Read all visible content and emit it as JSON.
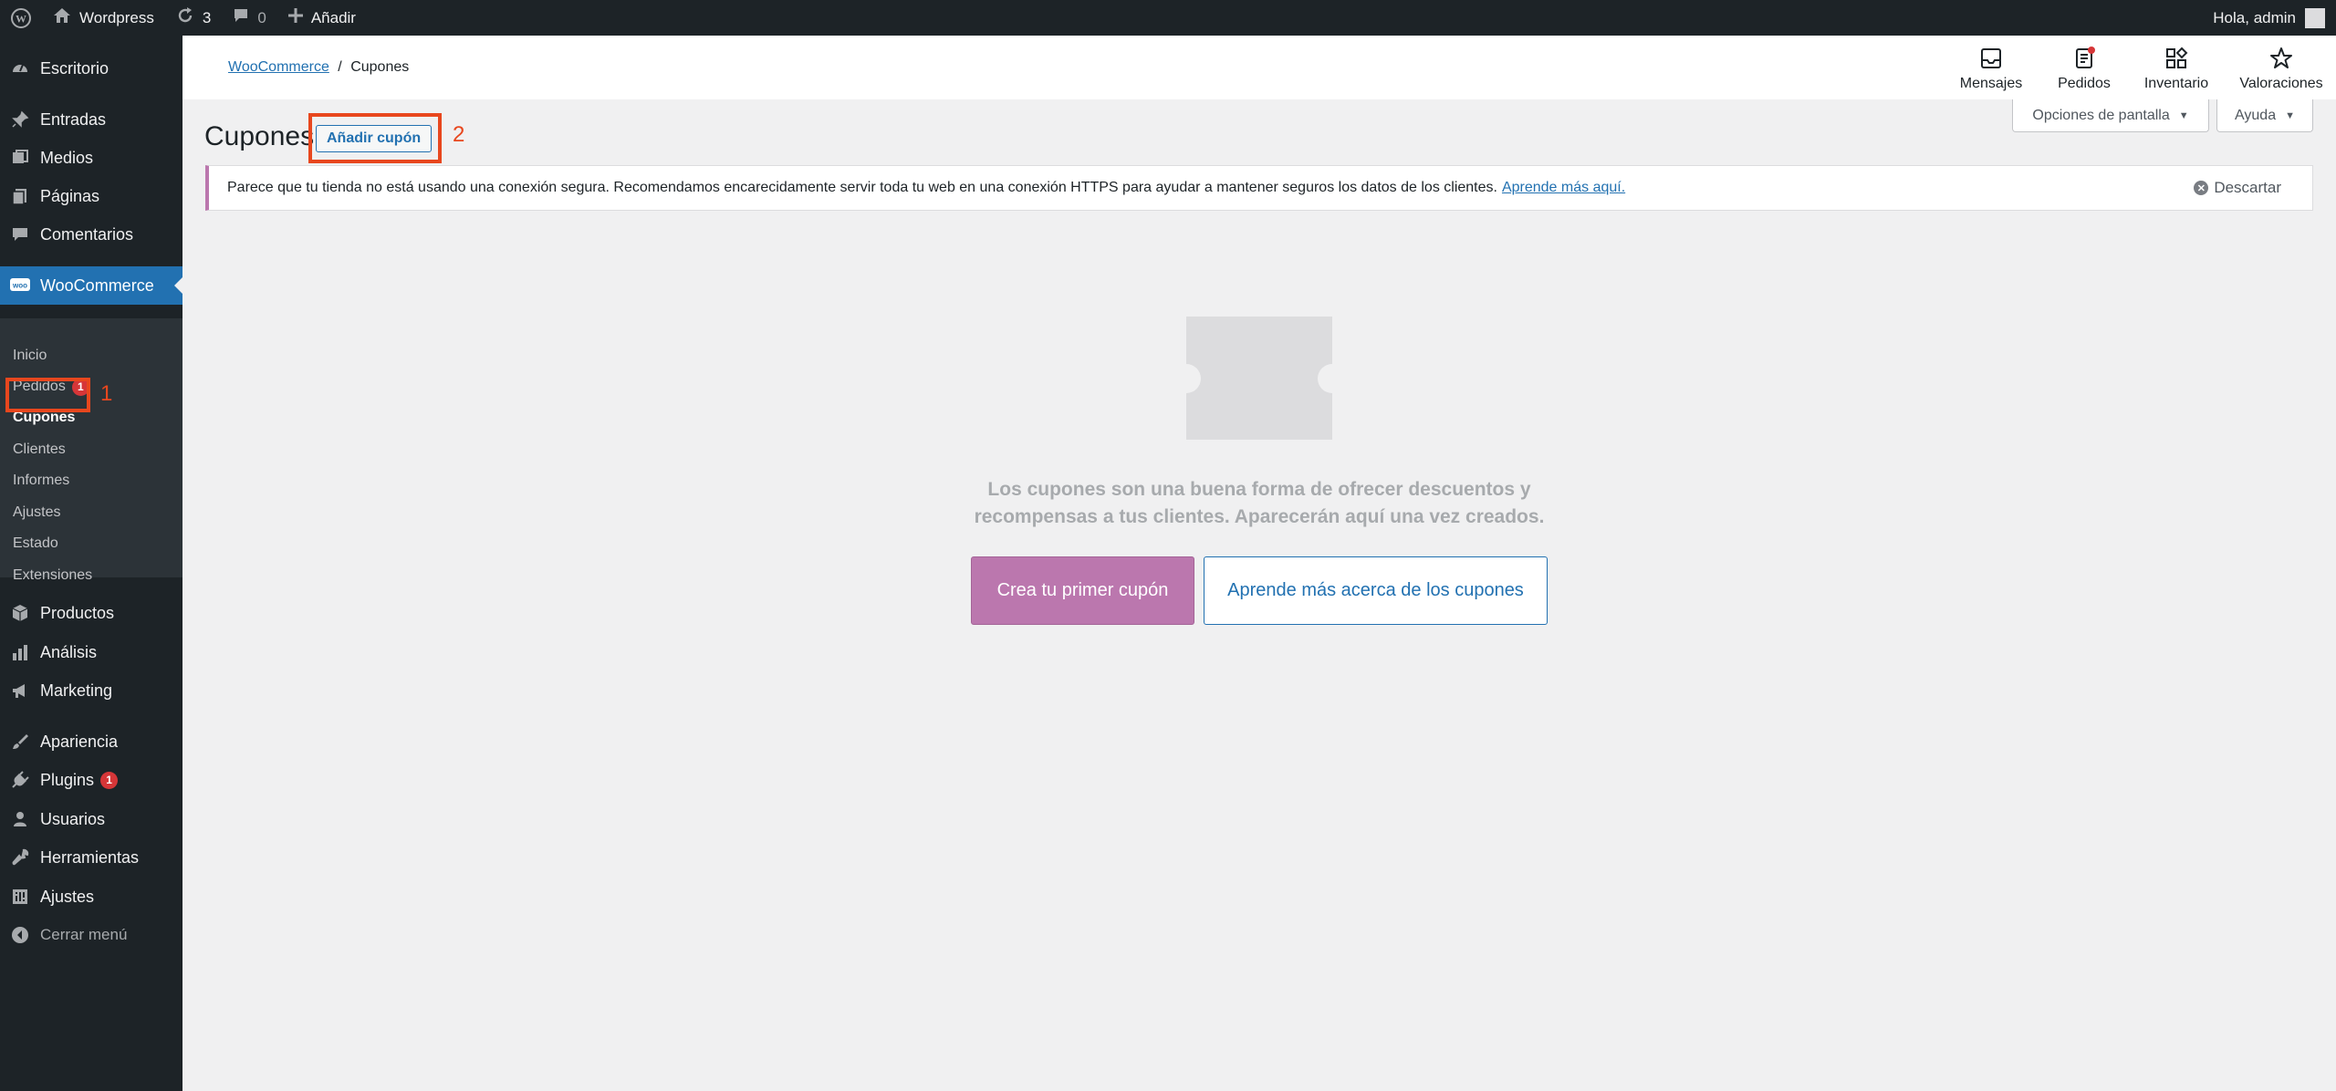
{
  "admin_bar": {
    "site_name": "Wordpress",
    "updates_count": "3",
    "comments_count": "0",
    "new_label": "Añadir",
    "greeting": "Hola, admin"
  },
  "sidebar": {
    "items": [
      {
        "label": "Escritorio",
        "icon": "dashboard-icon"
      },
      {
        "label": "Entradas",
        "icon": "pin-icon"
      },
      {
        "label": "Medios",
        "icon": "media-icon"
      },
      {
        "label": "Páginas",
        "icon": "pages-icon"
      },
      {
        "label": "Comentarios",
        "icon": "comment-icon"
      },
      {
        "label": "WooCommerce",
        "icon": "woo-icon"
      },
      {
        "label": "Productos",
        "icon": "box-icon"
      },
      {
        "label": "Análisis",
        "icon": "bar-chart-icon"
      },
      {
        "label": "Marketing",
        "icon": "megaphone-icon"
      },
      {
        "label": "Apariencia",
        "icon": "brush-icon"
      },
      {
        "label": "Plugins",
        "icon": "plugin-icon",
        "badge": "1"
      },
      {
        "label": "Usuarios",
        "icon": "user-icon"
      },
      {
        "label": "Herramientas",
        "icon": "wrench-icon"
      },
      {
        "label": "Ajustes",
        "icon": "settings-icon"
      }
    ],
    "collapse_label": "Cerrar menú",
    "submenu": [
      {
        "label": "Inicio"
      },
      {
        "label": "Pedidos",
        "badge": "1"
      },
      {
        "label": "Cupones"
      },
      {
        "label": "Clientes"
      },
      {
        "label": "Informes"
      },
      {
        "label": "Ajustes"
      },
      {
        "label": "Estado"
      },
      {
        "label": "Extensiones"
      }
    ]
  },
  "header": {
    "breadcrumb_root": "WooCommerce",
    "breadcrumb_sep": "/",
    "breadcrumb_current": "Cupones",
    "actions": [
      {
        "label": "Mensajes",
        "icon": "inbox-icon"
      },
      {
        "label": "Pedidos",
        "icon": "orders-icon"
      },
      {
        "label": "Inventario",
        "icon": "inventory-icon"
      },
      {
        "label": "Valoraciones",
        "icon": "star-icon"
      }
    ]
  },
  "screen_options_label": "Opciones de pantalla",
  "help_label": "Ayuda",
  "page": {
    "title": "Cupones",
    "add_button": "Añadir cupón"
  },
  "annotations": {
    "one": "1",
    "two": "2",
    "color": "#e8471e"
  },
  "notice": {
    "text": "Parece que tu tienda no está usando una conexión segura. Recomendamos encarecidamente servir toda tu web en una conexión HTTPS para ayudar a mantener seguros los datos de los clientes.",
    "link": "Aprende más aquí.",
    "dismiss": "Descartar"
  },
  "empty_state": {
    "message": "Los cupones son una buena forma de ofrecer descuentos y recompensas a tus clientes. Aparecerán aquí una vez creados.",
    "primary_button": "Crea tu primer cupón",
    "secondary_button": "Aprende más acerca de los cupones"
  },
  "colors": {
    "admin_dark": "#1d2327",
    "accent_blue": "#2271b1",
    "woo_purple": "#bb77ae",
    "badge_red": "#d63638"
  }
}
